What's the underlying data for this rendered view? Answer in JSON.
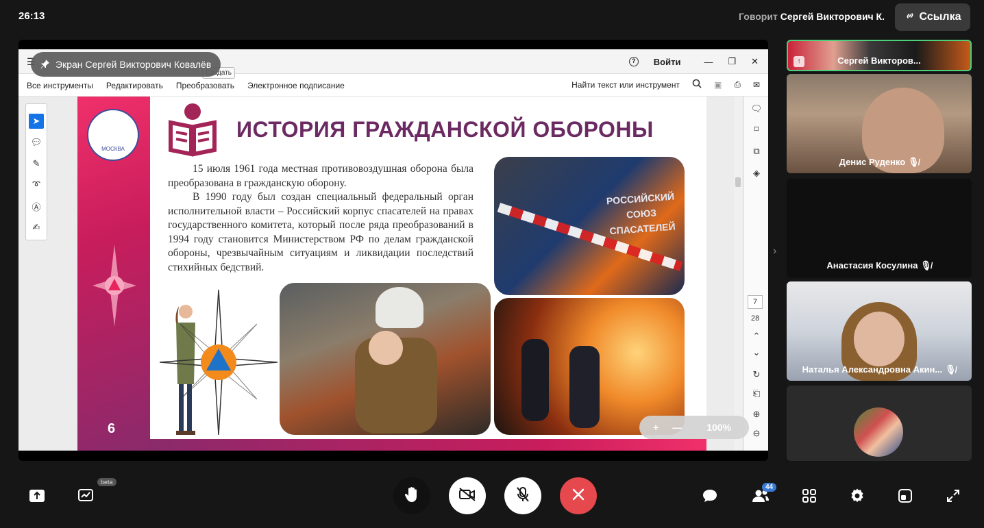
{
  "header": {
    "timer": "26:13",
    "speaker_prefix": "Говорит",
    "speaker_name": "Сергей Викторович К.",
    "link_label": "Ссылка"
  },
  "screen_share": {
    "pin_label": "Экран Сергей Викторович Ковалёв",
    "acrobat": {
      "create_label": "Создать",
      "signin_label": "Войти",
      "menu": [
        "Все инструменты",
        "Редактировать",
        "Преобразовать",
        "Электронное подписание"
      ],
      "search_label": "Найти текст или инструмент",
      "page_current": "7",
      "page_total": "28",
      "zoom": "100%"
    },
    "slide": {
      "title": "ИСТОРИЯ ГРАЖДАНСКОЙ ОБОРОНЫ",
      "paragraph1": "15 июля 1961 года местная противовоздушная оборона была преобразована в гражданскую оборону.",
      "paragraph2": "В 1990 году был создан специальный федеральный орган исполнительной власти – Российский корпус спасателей на правах государственного комитета, который после ряда преобразований в 1994 году становится Министерством РФ по делам гражданской обороны, чрезвычайным ситуациям и ликвидации последствий стихийных бедствий.",
      "jacket_text": "РОССИЙСКИЙ СОЮЗ СПАСАТЕЛЕЙ",
      "seal_text": "МОСКВА",
      "page_number": "6"
    }
  },
  "participants": [
    {
      "name": "Сергей Викторов...",
      "active": true
    },
    {
      "name": "Денис Руденко",
      "muted": true
    },
    {
      "name": "Анастасия Косулина",
      "muted": true
    },
    {
      "name": "Наталья Александровна Акин...",
      "muted": true
    },
    {
      "name": ""
    }
  ],
  "toolbar": {
    "beta_label": "beta",
    "participants_count": "44"
  },
  "colors": {
    "accent_green": "#4cd07a",
    "end_call_red": "#e5484d",
    "slide_title": "#6b2a62",
    "slide_pink": "#e8245f"
  }
}
